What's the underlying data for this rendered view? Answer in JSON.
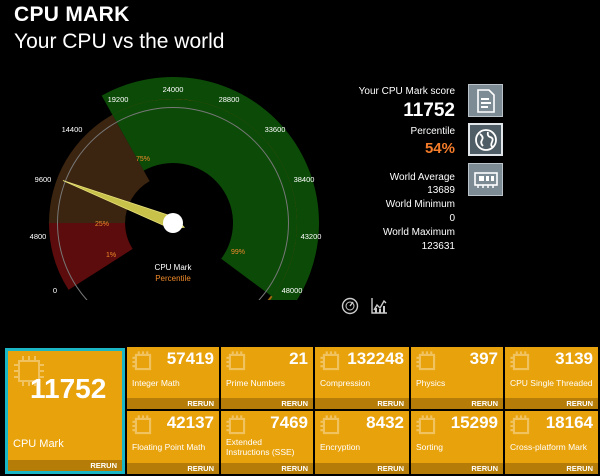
{
  "header": {
    "title": "CPU MARK",
    "subtitle": "Your CPU vs the world"
  },
  "gauge": {
    "ticks": [
      "0",
      "4800",
      "9600",
      "14400",
      "19200",
      "24000",
      "28800",
      "33600",
      "38400",
      "43200",
      "48000"
    ],
    "percentile_labels": [
      "1%",
      "25%",
      "75%",
      "99%"
    ],
    "center_label": "CPU Mark",
    "center_sublabel": "Percentile",
    "needle_value": 11752,
    "max": 48000,
    "zone_colors": {
      "red": "#5c0c0c",
      "brown": "#3b2410",
      "green": "#0c4a08",
      "edge": "#a0690f"
    }
  },
  "info": {
    "score_label": "Your CPU Mark score",
    "score": "11752",
    "percentile_label": "Percentile",
    "percentile": "54%",
    "avg_label": "World Average",
    "avg": "13689",
    "min_label": "World Minimum",
    "min": "0",
    "max_label": "World Maximum",
    "max": "123631"
  },
  "side_buttons": [
    "document-chart-icon",
    "globe-icon",
    "video-card-icon"
  ],
  "bottom_icons": [
    "gauge-icon",
    "chart-icon"
  ],
  "tiles": {
    "main": {
      "value": "11752",
      "label": "CPU Mark",
      "rerun": "RERUN"
    },
    "items": [
      {
        "value": "57419",
        "label": "Integer Math",
        "rerun": "RERUN"
      },
      {
        "value": "21",
        "label": "Prime Numbers",
        "rerun": "RERUN"
      },
      {
        "value": "132248",
        "label": "Compression",
        "rerun": "RERUN"
      },
      {
        "value": "397",
        "label": "Physics",
        "rerun": "RERUN"
      },
      {
        "value": "3139",
        "label": "CPU Single Threaded",
        "rerun": "RERUN"
      },
      {
        "value": "42137",
        "label": "Floating Point Math",
        "rerun": "RERUN"
      },
      {
        "value": "7469",
        "label": "Extended Instructions (SSE)",
        "rerun": "RERUN"
      },
      {
        "value": "8432",
        "label": "Encryption",
        "rerun": "RERUN"
      },
      {
        "value": "15299",
        "label": "Sorting",
        "rerun": "RERUN"
      },
      {
        "value": "18164",
        "label": "Cross-platform Mark",
        "rerun": "RERUN"
      }
    ]
  }
}
